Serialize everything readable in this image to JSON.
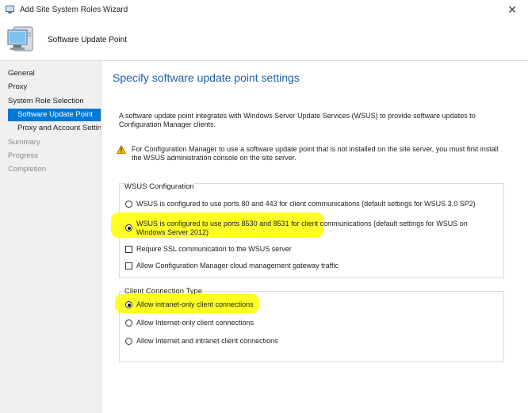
{
  "window": {
    "title": "Add Site System Roles Wizard",
    "close_glyph": "✕"
  },
  "header": {
    "title": "Software Update Point"
  },
  "sidebar": {
    "items": [
      {
        "label": "General",
        "state": "normal"
      },
      {
        "label": "Proxy",
        "state": "normal"
      },
      {
        "label": "System Role Selection",
        "state": "normal"
      },
      {
        "label": "Software Update Point",
        "state": "active"
      },
      {
        "label": "Proxy and Account Settin",
        "state": "normal"
      },
      {
        "label": "Summary",
        "state": "disabled"
      },
      {
        "label": "Progress",
        "state": "disabled"
      },
      {
        "label": "Completion",
        "state": "disabled"
      }
    ]
  },
  "main": {
    "heading": "Specify software update point settings",
    "description": "A software update point integrates with Windows Server Update Services (WSUS) to provide software updates to Configuration Manager clients.",
    "warning": "For Configuration Manager to use a software update point that is not installed on the site server, you must first install the WSUS administration console on the site server.",
    "wsus_group": {
      "title": "WSUS Configuration",
      "option_80_443": "WSUS is configured to use ports 80 and 443 for client communications (default settings for WSUS 3.0 SP2)",
      "option_8530_8531": "WSUS is configured to use ports 8530 and 8531 for client communications (default settings for WSUS on Windows Server 2012)",
      "selected": "option_8530_8531",
      "require_ssl": "Require SSL communication to the WSUS server",
      "require_ssl_checked": false,
      "allow_cmg": "Allow Configuration Manager cloud management gateway traffic",
      "allow_cmg_checked": false
    },
    "client_group": {
      "title": "Client Connection Type",
      "intranet_only": "Allow intranet-only client connections",
      "internet_only": "Allow Internet-only client connections",
      "both": "Allow Internet and intranet client connections",
      "selected": "intranet_only"
    }
  },
  "colors": {
    "accent": "#0078d7",
    "heading": "#1f5fa8",
    "highlight": "#ffff00"
  },
  "icons": {
    "app": "computer-icon",
    "header": "computer-icon",
    "warning": "warning-icon",
    "close": "close-icon"
  }
}
